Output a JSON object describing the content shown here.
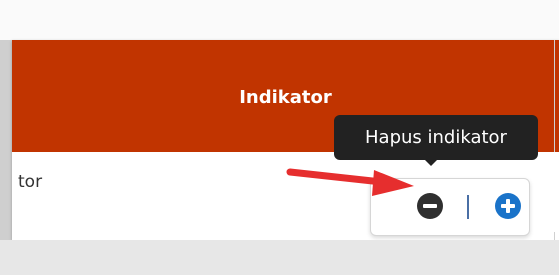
{
  "colors": {
    "header_bg": "#c13400",
    "tooltip_bg": "#222222",
    "remove_button": "#2f2f2f",
    "add_button": "#1a73c9",
    "pointer_arrow": "#e62e2e"
  },
  "table": {
    "header_title": "Indikator",
    "row_text": "tor"
  },
  "actions": {
    "remove_icon": "minus-circle-icon",
    "add_icon": "plus-circle-icon"
  },
  "tooltip": {
    "text": "Hapus indikator"
  },
  "annotation": {
    "icon": "red-arrow-icon"
  }
}
